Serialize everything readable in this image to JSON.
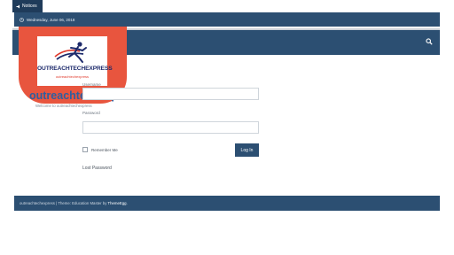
{
  "topbar": {
    "notices_label": "Notices",
    "date": "Wednesday, June 06, 2018"
  },
  "logo": {
    "name": "OUTREACHTECHEXPRESS",
    "tagline": "outreachtechexpress"
  },
  "site": {
    "title": "outreachtechexpress",
    "description": "Welcome to outreachtechexpress"
  },
  "login": {
    "username_label": "Username",
    "password_label": "Password",
    "remember_label": "Remember Me",
    "submit_label": "Log In",
    "lost_password": "Lost Password"
  },
  "footer": {
    "site": "outreachtechexpress",
    "separator": " | ",
    "theme_text": "Theme: Education Master by ",
    "theme_author": "ThemeEgg",
    "end": "."
  },
  "colors": {
    "primary": "#2c4f72",
    "logo_badge": "#e8553e",
    "title_blue": "#2d5fa0"
  },
  "icons": [
    "bullhorn-icon",
    "clock-icon",
    "search-icon",
    "logo-runner-icon"
  ]
}
